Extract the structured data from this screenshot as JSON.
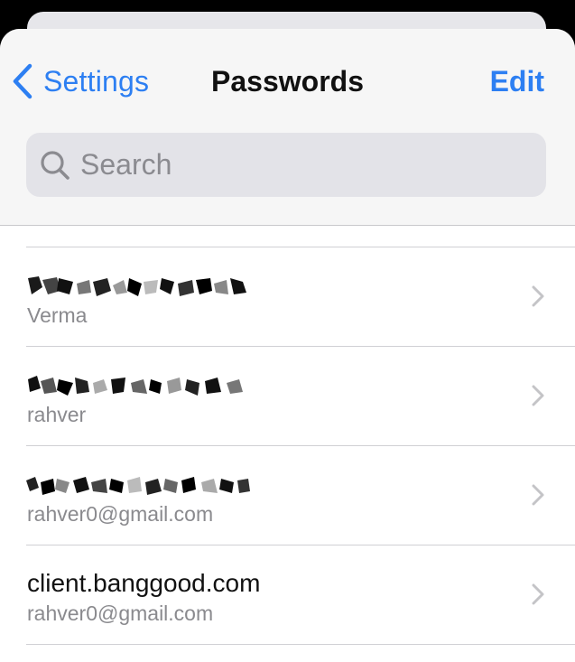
{
  "nav": {
    "back_label": "Settings",
    "title": "Passwords",
    "edit_label": "Edit"
  },
  "search": {
    "placeholder": "Search",
    "value": ""
  },
  "accounts": [
    {
      "title": "",
      "subtitle": "Verma",
      "title_redacted": true
    },
    {
      "title": "",
      "subtitle": "rahver",
      "title_redacted": true
    },
    {
      "title": "",
      "subtitle": "rahver0@gmail.com",
      "title_redacted": true
    },
    {
      "title": "client.banggood.com",
      "subtitle": "rahver0@gmail.com",
      "title_redacted": false
    }
  ],
  "colors": {
    "accent": "#2d7ff2",
    "secondary_text": "#8a8a8e",
    "header_bg": "#f6f6f6",
    "search_bg": "#e3e3e8"
  },
  "icons": {
    "back": "chevron-left-icon",
    "search": "magnifier-search-icon",
    "row_disclosure": "chevron-right-icon"
  }
}
